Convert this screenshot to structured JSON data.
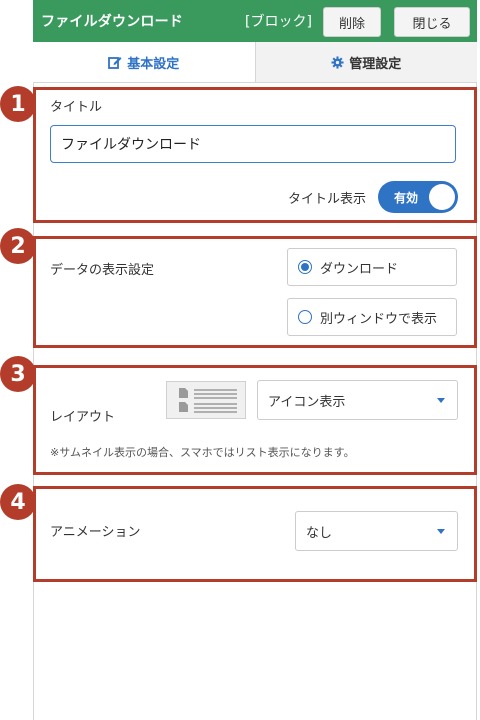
{
  "header": {
    "title": "ファイルダウンロード",
    "tag": "[ブロック]",
    "delete_label": "削除",
    "close_label": "閉じる",
    "color": "#3a9a5e"
  },
  "tabs": [
    {
      "label": "基本設定",
      "icon": "edit-icon",
      "active": true
    },
    {
      "label": "管理設定",
      "icon": "gear-icon",
      "active": false
    }
  ],
  "markers": [
    "1",
    "2",
    "3",
    "4"
  ],
  "section1": {
    "title_label": "タイトル",
    "title_value": "ファイルダウンロード",
    "display_label": "タイトル表示",
    "toggle_label": "有効",
    "toggle_on": true
  },
  "section2": {
    "label": "データの表示設定",
    "options": [
      {
        "label": "ダウンロード",
        "selected": true
      },
      {
        "label": "別ウィンドウで表示",
        "selected": false
      }
    ]
  },
  "section3": {
    "label": "レイアウト",
    "selected": "アイコン表示",
    "note": "※サムネイル表示の場合、スマホではリスト表示になります。"
  },
  "section4": {
    "label": "アニメーション",
    "selected": "なし"
  },
  "colors": {
    "accent": "#2f73c4",
    "frame": "#b33d2a"
  }
}
